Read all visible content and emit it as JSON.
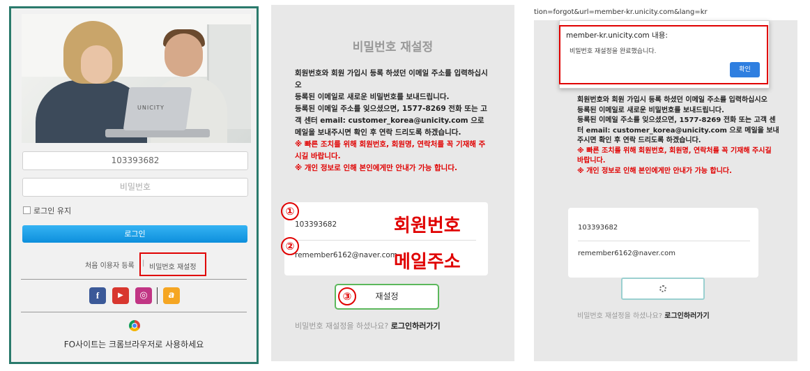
{
  "panel1": {
    "member_id_value": "103393682",
    "password_placeholder": "비밀번호",
    "keep_login_label": "로그인 유지",
    "login_button": "로그인",
    "first_time_register": "처음 이용자 등록",
    "separator": "|",
    "password_reset_link": "비밀번호 재설정",
    "social": [
      {
        "name": "facebook-icon",
        "glyph": "f",
        "color": "#3b5998"
      },
      {
        "name": "youtube-icon",
        "glyph": "▶",
        "color": "#d8372f"
      },
      {
        "name": "instagram-icon",
        "glyph": "◎",
        "color": "#c13584"
      },
      {
        "name": "a-icon",
        "glyph": "a",
        "color": "#f5a623"
      }
    ],
    "browser_note": "FO사이트는 크롬브라우저로 사용하세요",
    "laptop_logo": "UNICITY"
  },
  "panel2": {
    "title": "비밀번호 재설정",
    "instructions": [
      "회원번호와 회원 가입시 등록 하셨던 이메일 주소를 입력하십시오",
      "등록된 이메일로 새로운 비밀번호를 보내드립니다.",
      "등록된 이메일 주소를 잊으셨으면, 1577-8269 전화 또는 고객 센터 email: customer_korea@unicity.com 으로 메일을 보내주시면 확인 후 연락 드리도록 하겠습니다."
    ],
    "warnings": [
      "※ 빠른 조치를 위해 회원번호, 회원명, 연락처를 꼭 기재해 주시길 바랍니다.",
      "※ 개인 정보로 인해 본인에게만 안내가 가능 합니다."
    ],
    "member_id_value": "103393682",
    "email_value": "remember6162@naver.com",
    "annotation_id": "회원번호",
    "annotation_email": "메일주소",
    "step1": "①",
    "step2": "②",
    "step3": "③",
    "reset_button": "재설정",
    "footer_question": "비밀번호 재설정을 하셨나요?",
    "footer_link": "로그인하러가기"
  },
  "panel3": {
    "url": "tion=forgot&url=member-kr.unicity.com&lang=kr",
    "dialog_title": "member-kr.unicity.com 내용:",
    "dialog_message": "비밀번호 재설정을 완료했습니다.",
    "dialog_ok": "확인",
    "instructions": [
      "회원번호와 회원 가입시 등록 하셨던 이메일 주소를 입력하십시오",
      "등록된 이메일로 새로운 비밀번호를 보내드립니다.",
      "등록된 이메일 주소를 잊으셨으면, 1577-8269 전화 또는 고객 센터 email: customer_korea@unicity.com 으로 메일을 보내주시면 확인 후 연락 드리도록 하겠습니다."
    ],
    "warnings": [
      "※ 빠른 조치를 위해 회원번호, 회원명, 연락처를 꼭 기재해 주시길 바랍니다.",
      "※ 개인 정보로 인해 본인에게만 안내가 가능 합니다."
    ],
    "member_id_value": "103393682",
    "email_value": "remember6162@naver.com",
    "footer_question": "비밀번호 재설정을 하셨나요?",
    "footer_link": "로그인하러가기"
  },
  "colors": {
    "annotation_red": "#e00000",
    "login_blue": "#1a9be6",
    "frame_green": "#2a7a6c"
  }
}
